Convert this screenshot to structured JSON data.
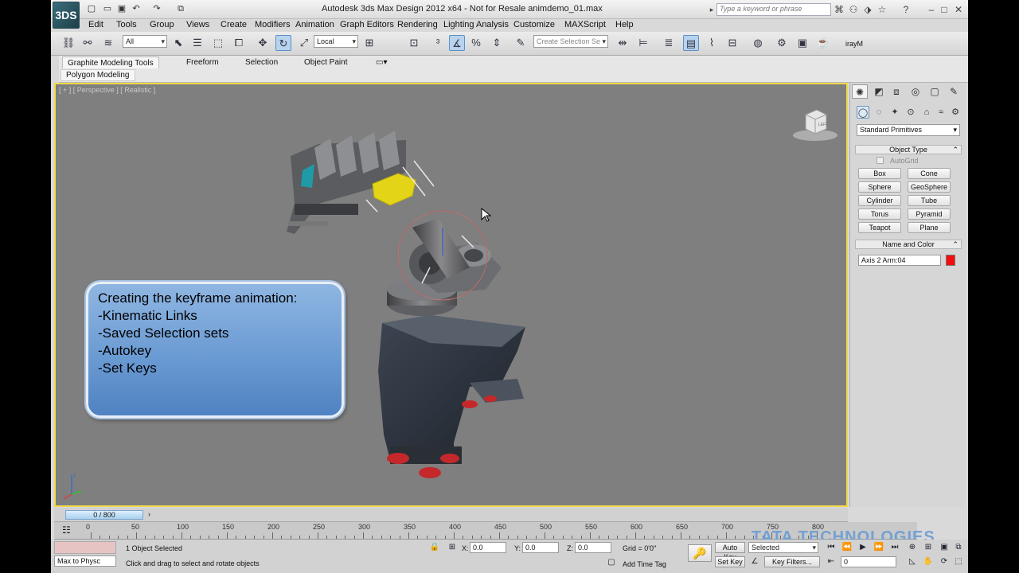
{
  "titlebar": {
    "logo": "3DS",
    "title": "Autodesk 3ds Max Design 2012 x64    -   Not for Resale     animdemo_01.max",
    "search_placeholder": "Type a keyword or phrase"
  },
  "menu": [
    "Edit",
    "Tools",
    "Group",
    "Views",
    "Create",
    "Modifiers",
    "Animation",
    "Graph Editors",
    "Rendering",
    "Lighting Analysis",
    "Customize",
    "MAXScript",
    "Help"
  ],
  "toolbar": {
    "selection_filter": "All",
    "ref_coord": "Local",
    "selection_set_placeholder": "Create Selection Se",
    "renderer_label": "irayM"
  },
  "ribbon": {
    "tabs": [
      "Graphite Modeling Tools",
      "Freeform",
      "Selection",
      "Object Paint"
    ],
    "active_panel": "Polygon Modeling"
  },
  "viewport": {
    "label": "[ + ] [ Perspective ] [ Realistic ]",
    "viewcube_face": "LEFT",
    "callout_lines": [
      "Creating the keyframe animation:",
      "-Kinematic Links",
      "-Saved Selection sets",
      "-Autokey",
      "-Set Keys"
    ]
  },
  "command_panel": {
    "category": "Standard Primitives",
    "object_type_header": "Object Type",
    "autogrid": "AutoGrid",
    "buttons": [
      "Box",
      "Cone",
      "Sphere",
      "GeoSphere",
      "Cylinder",
      "Tube",
      "Torus",
      "Pyramid",
      "Teapot",
      "Plane"
    ],
    "name_color_header": "Name and Color",
    "object_name": "Axis 2 Arm:04",
    "object_color": "#f30d0d"
  },
  "timeline": {
    "slider_text": "0 / 800",
    "ticks": [
      "0",
      "50",
      "100",
      "150",
      "200",
      "250",
      "300",
      "350",
      "400",
      "450",
      "500",
      "550",
      "600",
      "650",
      "700",
      "750",
      "800"
    ]
  },
  "watermark": "TATA TECHNOLOGIES",
  "status": {
    "maxscript": "Max to Physc",
    "selection": "1 Object Selected",
    "prompt": "Click and drag to select and rotate objects",
    "x_label": "X:",
    "x_value": "0.0",
    "y_label": "Y:",
    "y_value": "0.0",
    "z_label": "Z:",
    "z_value": "0.0",
    "grid": "Grid = 0'0\"",
    "add_time_tag": "Add Time Tag",
    "auto_key": "Auto Key",
    "set_key": "Set Key",
    "key_mode": "Selected",
    "key_filters": "Key Filters...",
    "frame": "0"
  }
}
